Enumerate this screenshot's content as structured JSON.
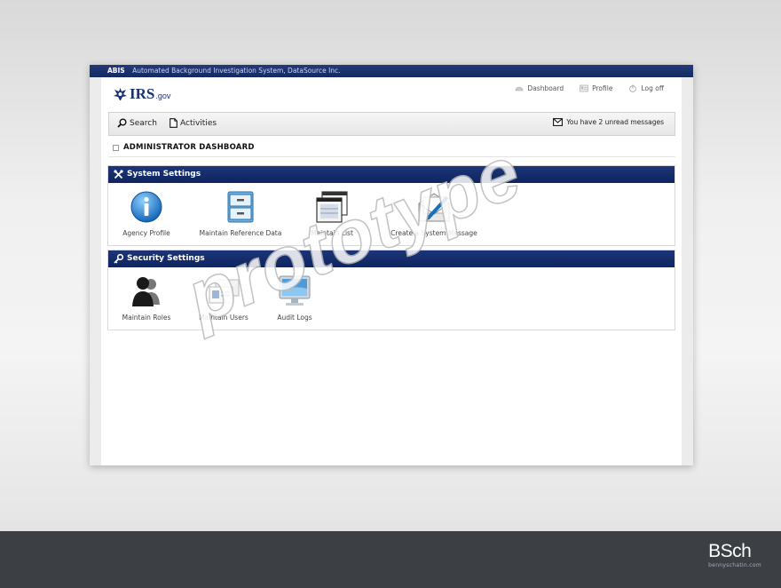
{
  "topbar": {
    "acronym": "ABIS",
    "system_name": "Automated Background Investigation System, DataSource Inc."
  },
  "logo": {
    "main": "IRS",
    "suffix": ".gov"
  },
  "toplinks": [
    {
      "label": "Dashboard",
      "icon": "dashboard-icon"
    },
    {
      "label": "Profile",
      "icon": "profile-card-icon"
    },
    {
      "label": "Log off",
      "icon": "power-icon"
    }
  ],
  "nav": {
    "search_label": "Search",
    "activities_label": "Activities",
    "messages_text": "You have 2 unread messages"
  },
  "dashboard": {
    "title": "ADMINISTRATOR DASHBOARD"
  },
  "system_settings": {
    "title": "System Settings",
    "items": [
      {
        "label": "Agency Profile",
        "icon": "info-icon"
      },
      {
        "label": "Maintain Reference Data",
        "icon": "filing-cabinet-icon"
      },
      {
        "label": "Maintain List",
        "icon": "list-windows-icon"
      },
      {
        "label": "Create a System Message",
        "icon": "mail-pen-icon"
      }
    ]
  },
  "security_settings": {
    "title": "Security Settings",
    "items": [
      {
        "label": "Maintain Roles",
        "icon": "users-icon"
      },
      {
        "label": "Maintain Users",
        "icon": "id-cards-icon"
      },
      {
        "label": "Audit Logs",
        "icon": "monitor-icon"
      }
    ]
  },
  "watermark": "prototype",
  "branding": {
    "logo": "BSch",
    "sub": "bennyschatin.com"
  },
  "colors": {
    "navy": "#142a62",
    "footer": "#3c4045"
  }
}
